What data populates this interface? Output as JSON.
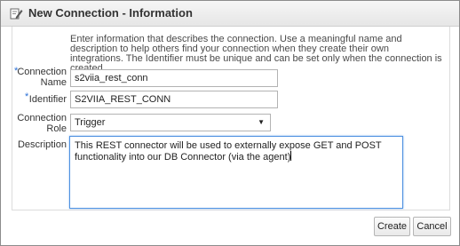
{
  "dialog": {
    "title": "New Connection - Information",
    "title_icon": "edit-connection-icon"
  },
  "intro": "Enter information that describes the connection. Use a meaningful name and description to help others find your connection when they create their own integrations. The Identifier must be unique and can be set only when the connection is created.",
  "form": {
    "required_marker": "*",
    "connection_name": {
      "label_line1": "Connection",
      "label_line2": "Name",
      "value": "s2viia_rest_conn"
    },
    "identifier": {
      "label": "Identifier",
      "value": "S2VIIA_REST_CONN"
    },
    "connection_role": {
      "label_line1": "Connection",
      "label_line2": "Role",
      "selected": "Trigger",
      "arrow": "▼"
    },
    "description": {
      "label": "Description",
      "value": "This REST connector will be used to externally expose GET and POST functionality into our DB Connector (via the agent)"
    }
  },
  "buttons": {
    "create": "Create",
    "cancel": "Cancel"
  },
  "colors": {
    "required_marker": "#2a6fd6",
    "focus_border": "#4d90e0"
  }
}
